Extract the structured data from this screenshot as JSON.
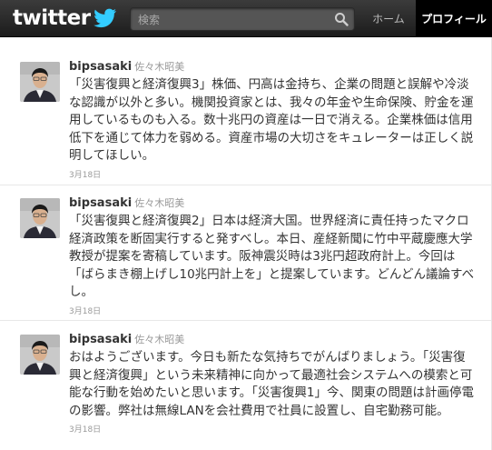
{
  "header": {
    "logo_text": "twitter",
    "search_placeholder": "検索",
    "nav_home": "ホーム",
    "nav_profile": "プロフィール"
  },
  "tweets": [
    {
      "screen_name": "bipsasaki",
      "real_name": "佐々木昭美",
      "text": "「災害復興と経済復興3」株価、円高は金持ち、企業の問題と誤解や冷淡な認識が以外と多い。機関投資家とは、我々の年金や生命保険、貯金を運用しているものも入る。数十兆円の資産は一日で消える。企業株価は信用低下を通じて体力を弱める。資産市場の大切さをキュレーターは正しく説明してほしい。",
      "time": "3月18日"
    },
    {
      "screen_name": "bipsasaki",
      "real_name": "佐々木昭美",
      "text": "「災害復興と経済復興2」日本は経済大国。世界経済に責任持ったマクロ経済政策を断固実行すると発すべし。本日、産経新聞に竹中平蔵慶應大学教授が提案を寄稿しています。阪神震災時は3兆円超政府計上。今回は「ばらまき棚上げし10兆円計上を」と提案しています。どんどん議論すべし。",
      "time": "3月18日"
    },
    {
      "screen_name": "bipsasaki",
      "real_name": "佐々木昭美",
      "text": "おはようございます。今日も新たな気持ちでがんばりましょう。「災害復興と経済復興」という未来精神に向かって最適社会システムへの模索と可能な行動を始めたいと思います。「災害復興1」今、関東の問題は計画停電の影響。弊社は無線LANを会社費用で社員に設置し、自宅勤務可能。",
      "time": "3月18日"
    }
  ]
}
